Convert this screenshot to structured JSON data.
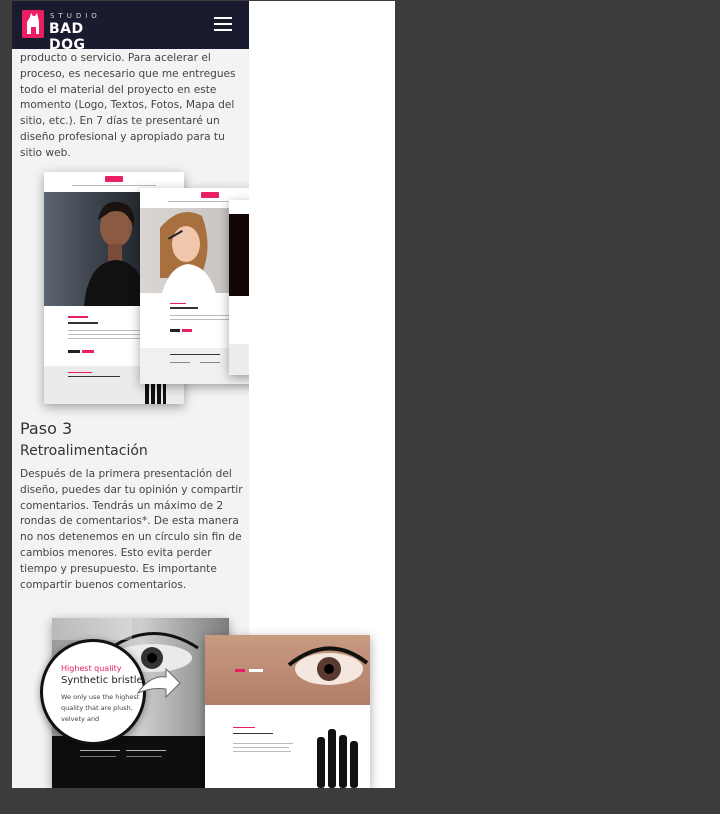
{
  "header": {
    "logo_small": "STUDIO",
    "logo_brand": "BAD DOG",
    "menu_icon": "hamburger-menu-icon"
  },
  "content": {
    "para1": "producto o servicio. Para acelerar el proceso, es necesario que me entregues todo el material del proyecto en este momento (Logo, Textos, Fotos, Mapa del sitio, etc.). En 7 días te presentaré un diseño profesional y apropiado para tu sitio web.",
    "step_title": "Paso 3",
    "step_subtitle": "Retroalimentación",
    "para2": "Después de la primera presentación del diseño, puedes dar tu opinión y compartir comentarios. Tendrás un máximo de 2 rondas de comentarios*. De esta manera no nos detenemos en un círculo sin fin de cambios menores. Esto evita perder tiempo y presupuesto. Es importante compartir buenos comentarios."
  },
  "mockup2": {
    "callout_label": "Highest quality",
    "callout_title": "Synthetic bristle",
    "callout_body": "We only use the highest quality that are plush, velvety and"
  },
  "colors": {
    "accent": "#e91e63",
    "header_bg": "#1b1b2f",
    "backdrop": "#3c3c3c",
    "column_bg": "#f3f3f3"
  }
}
